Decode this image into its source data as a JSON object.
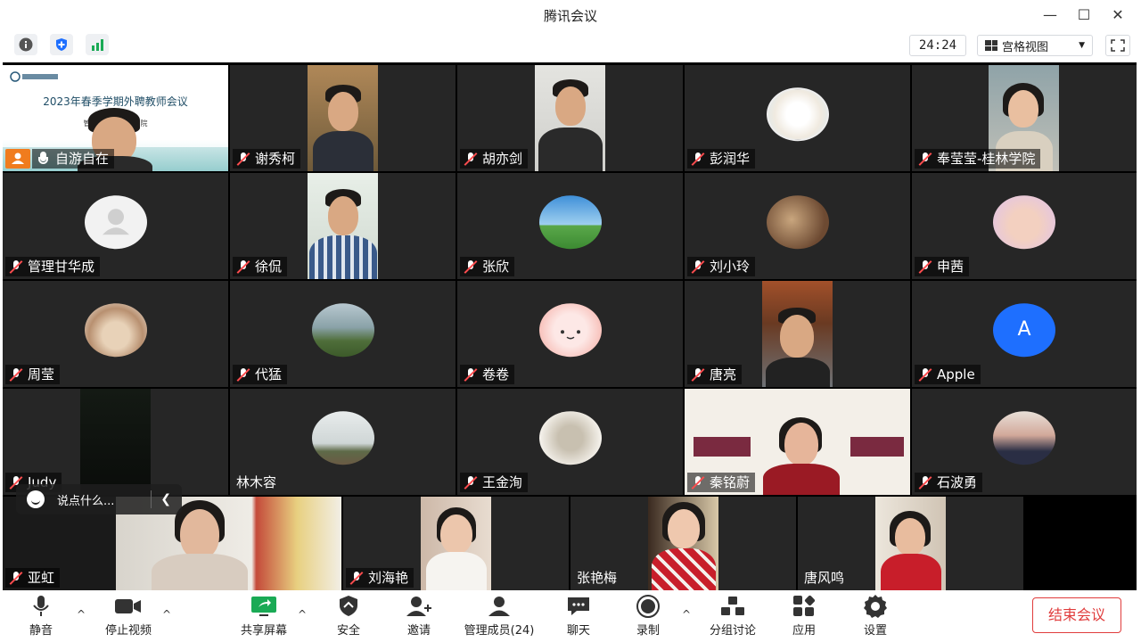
{
  "window": {
    "title": "腾讯会议"
  },
  "topbar": {
    "timer": "24:24",
    "view_mode": "宫格视图"
  },
  "slide": {
    "title": "2023年春季学期外聘教师会议",
    "line": "管理工……中周学院"
  },
  "participants": [
    {
      "name": "自游自在",
      "muted": false,
      "host": true
    },
    {
      "name": "谢秀柯",
      "muted": true
    },
    {
      "name": "胡亦剑",
      "muted": true
    },
    {
      "name": "彭润华",
      "muted": true
    },
    {
      "name": "奉莹莹-桂林学院",
      "muted": true
    },
    {
      "name": "管理甘华成",
      "muted": true
    },
    {
      "name": "徐侃",
      "muted": true
    },
    {
      "name": "张欣",
      "muted": true
    },
    {
      "name": "刘小玲",
      "muted": true
    },
    {
      "name": "申茜",
      "muted": true
    },
    {
      "name": "周莹",
      "muted": true
    },
    {
      "name": "代猛",
      "muted": true
    },
    {
      "name": "卷卷",
      "muted": true
    },
    {
      "name": "唐亮",
      "muted": true
    },
    {
      "name": "Apple",
      "muted": true,
      "initial": "A"
    },
    {
      "name": "Judy",
      "muted": true
    },
    {
      "name": "林木容",
      "muted": false
    },
    {
      "name": "王金洵",
      "muted": true
    },
    {
      "name": "秦铭蔚",
      "muted": true
    },
    {
      "name": "石波勇",
      "muted": true
    },
    {
      "name": "亚虹",
      "muted": true
    },
    {
      "name": "刘海艳",
      "muted": true
    },
    {
      "name": "张艳梅",
      "muted": false
    },
    {
      "name": "唐风鸣",
      "muted": false
    }
  ],
  "chat": {
    "placeholder": "说点什么..."
  },
  "toolbar": {
    "mute": "静音",
    "stop_video": "停止视频",
    "share": "共享屏幕",
    "security": "安全",
    "invite": "邀请",
    "members": "管理成员(24)",
    "chat": "聊天",
    "record": "录制",
    "breakout": "分组讨论",
    "apps": "应用",
    "settings": "设置",
    "end": "结束会议"
  },
  "colors": {
    "end_red": "#e03c3c",
    "accent_blue": "#1e6fff",
    "share_green": "#1aaa55"
  }
}
